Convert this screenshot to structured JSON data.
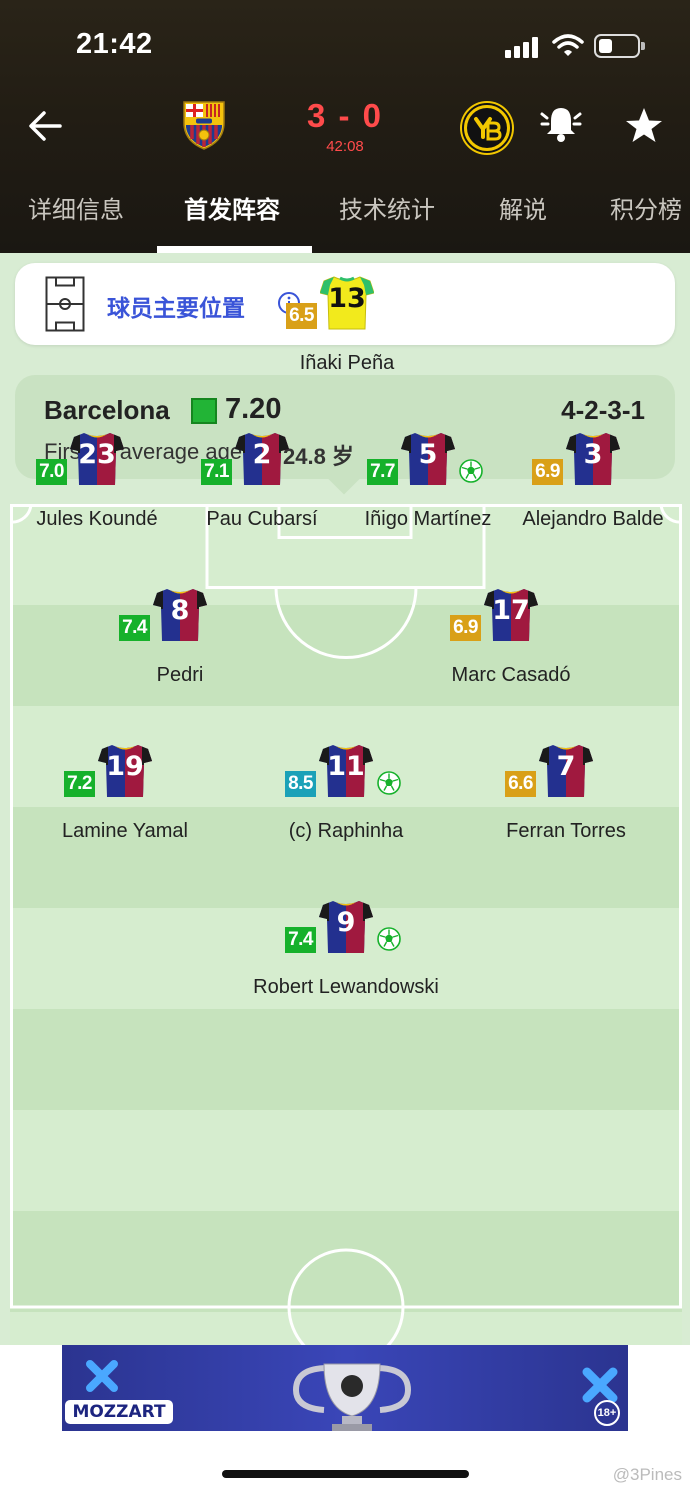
{
  "status_bar": {
    "time": "21:42"
  },
  "match": {
    "score": "3 - 0",
    "clock": "42:08",
    "home_crest": "barcelona-crest",
    "away_crest": "young-boys-crest"
  },
  "tabs": [
    {
      "label": "详细信息",
      "active": false
    },
    {
      "label": "首发阵容",
      "active": true
    },
    {
      "label": "技术统计",
      "active": false
    },
    {
      "label": "解说",
      "active": false
    },
    {
      "label": "积分榜",
      "active": false
    }
  ],
  "positions_card": {
    "label": "球员主要位置"
  },
  "team": {
    "name": "Barcelona",
    "rating": "7.20",
    "formation": "4-2-3-1",
    "age_label": "First XI average age",
    "age_value": "24.8 岁"
  },
  "players": [
    {
      "name": "Iñaki Peña",
      "number": "13",
      "rating": "6.5",
      "rating_color": "orange",
      "goal": false,
      "gk": true
    },
    {
      "name": "Jules Koundé",
      "number": "23",
      "rating": "7.0",
      "rating_color": "green",
      "goal": false
    },
    {
      "name": "Pau Cubarsí",
      "number": "2",
      "rating": "7.1",
      "rating_color": "green",
      "goal": false
    },
    {
      "name": "Iñigo Martínez",
      "number": "5",
      "rating": "7.7",
      "rating_color": "green",
      "goal": true
    },
    {
      "name": "Alejandro Balde",
      "number": "3",
      "rating": "6.9",
      "rating_color": "orange",
      "goal": false
    },
    {
      "name": "Pedri",
      "number": "8",
      "rating": "7.4",
      "rating_color": "green",
      "goal": false
    },
    {
      "name": "Marc Casadó",
      "number": "17",
      "rating": "6.9",
      "rating_color": "orange",
      "goal": false
    },
    {
      "name": "Lamine Yamal",
      "number": "19",
      "rating": "7.2",
      "rating_color": "green",
      "goal": false
    },
    {
      "name": "(c) Raphinha",
      "number": "11",
      "rating": "8.5",
      "rating_color": "teal",
      "goal": true
    },
    {
      "name": "Ferran Torres",
      "number": "7",
      "rating": "6.6",
      "rating_color": "orange",
      "goal": false
    },
    {
      "name": "Robert Lewandowski",
      "number": "9",
      "rating": "7.4",
      "rating_color": "green",
      "goal": true
    }
  ],
  "ad": {
    "brand": "MOZZART",
    "age_badge": "18+"
  },
  "watermark": "@3Pines",
  "colors": {
    "score": "#ff4b4b",
    "rating_green": "#16b12b",
    "rating_orange": "#d9a018",
    "rating_teal": "#1aa1b8",
    "link_blue": "#3a54d8"
  }
}
